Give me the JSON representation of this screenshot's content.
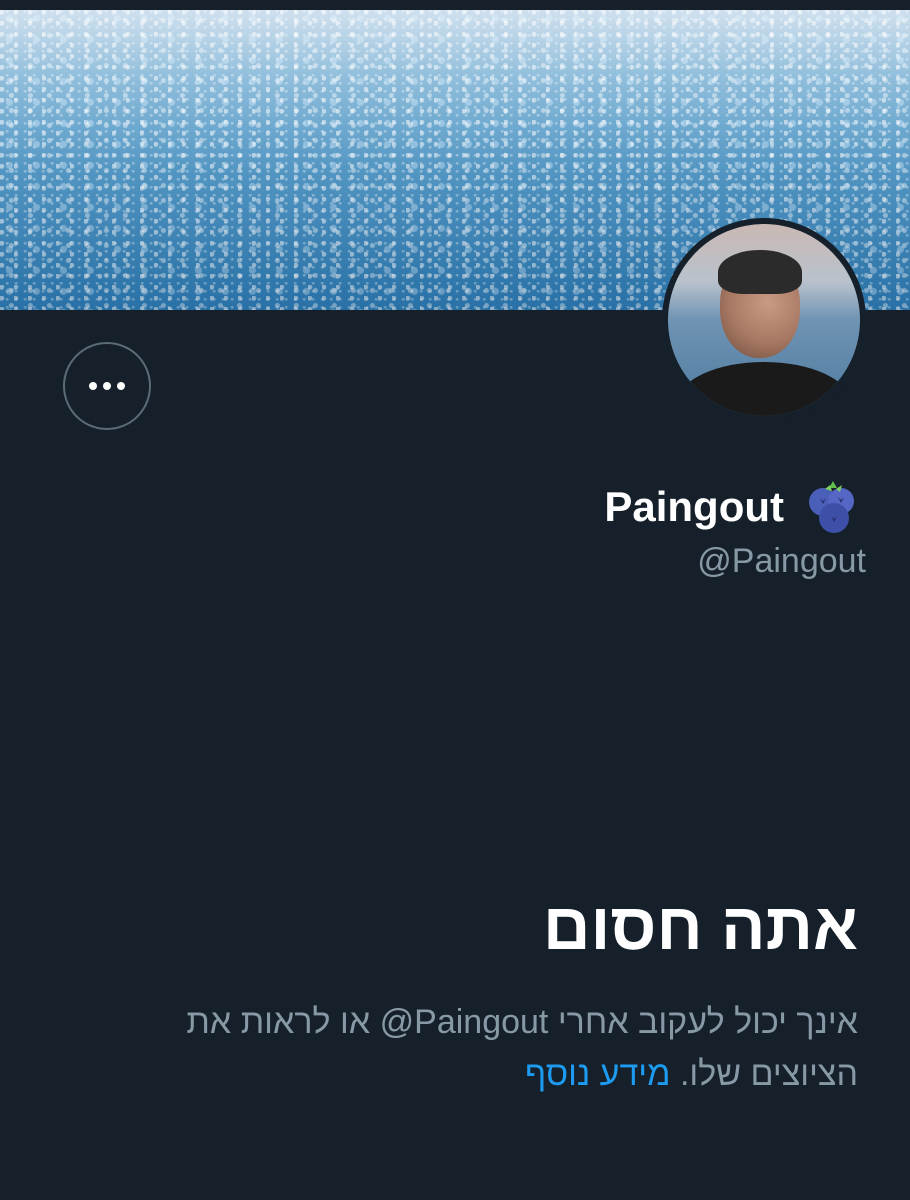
{
  "profile": {
    "display_name": "Paingout",
    "name_emoji": "blueberries-emoji",
    "handle": "@Paingout",
    "banner": "sparkling-sea-banner",
    "avatar": "profile-photo"
  },
  "actions": {
    "more_icon": "more-horizontal-icon"
  },
  "blocked": {
    "title": "אתה חסום",
    "description": "אינך יכול לעקוב אחרי ‎@Paingout‎ או לראות את הציוצים שלו.",
    "learn_more": "מידע נוסף"
  },
  "colors": {
    "background": "#15202b",
    "primary_text": "#ffffff",
    "secondary_text": "#8899a6",
    "link": "#1d9bf0"
  }
}
